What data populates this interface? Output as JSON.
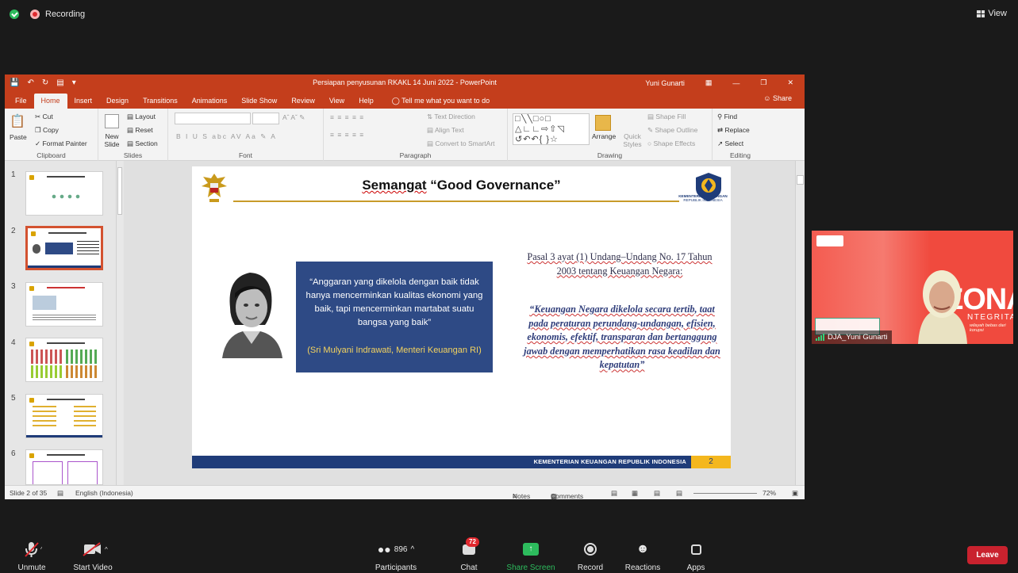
{
  "zoom": {
    "recording_label": "Recording",
    "view_label": "View",
    "toolbar": {
      "unmute": "Unmute",
      "start_video": "Start Video",
      "participants": "Participants",
      "participants_count": "896",
      "chat": "Chat",
      "chat_badge": "72",
      "share_screen": "Share Screen",
      "record": "Record",
      "reactions": "Reactions",
      "apps": "Apps",
      "leave": "Leave"
    },
    "video_tile": {
      "name": "DJA_Yuni Gunarti",
      "zona": "ZONA",
      "integritas": "NTEGRITAS",
      "tagline": "wilayah bebas dari korupsi"
    },
    "colors": {
      "record": "#e0282e",
      "share": "#2dbb5d",
      "leave": "#c9222e"
    }
  },
  "ppt": {
    "doc_title": "Persiapan penyusunan RKAKL 14 Juni 2022 - PowerPoint",
    "user": "Yuni Gunarti",
    "tabs": [
      "File",
      "Home",
      "Insert",
      "Design",
      "Transitions",
      "Animations",
      "Slide Show",
      "Review",
      "View",
      "Help"
    ],
    "active_tab": "Home",
    "tell_me": "Tell me what you want to do",
    "share": "Share",
    "ribbon": {
      "clipboard": {
        "paste": "Paste",
        "cut": "Cut",
        "copy": "Copy",
        "format_painter": "Format Painter",
        "label": "Clipboard"
      },
      "slides": {
        "new_slide": "New Slide",
        "layout": "Layout",
        "reset": "Reset",
        "section": "Section",
        "label": "Slides"
      },
      "font": {
        "label": "Font"
      },
      "paragraph": {
        "text_direction": "Text Direction",
        "align_text": "Align Text",
        "convert_smartart": "Convert to SmartArt",
        "label": "Paragraph"
      },
      "drawing": {
        "arrange": "Arrange",
        "quick_styles": "Quick Styles",
        "shape_fill": "Shape Fill",
        "shape_outline": "Shape Outline",
        "shape_effects": "Shape Effects",
        "label": "Drawing"
      },
      "editing": {
        "find": "Find",
        "replace": "Replace",
        "select": "Select",
        "label": "Editing"
      }
    },
    "thumbnails": [
      "1",
      "2",
      "3",
      "4",
      "5",
      "6"
    ],
    "selected_slide": "2",
    "slide": {
      "title_plain": "Semangat",
      "title_rest": " “Good Governance”",
      "ministry": "KEMENTERIAN KEUANGAN",
      "ministry_sub": "REPUBLIK INDONESIA",
      "quote": "“Anggaran yang dikelola dengan baik tidak hanya mencerminkan kualitas ekonomi yang baik, tapi mencerminkan martabat suatu bangsa yang baik”",
      "quote_author": "(Sri Mulyani Indrawati, Menteri Keuangan RI)",
      "pasal": "Pasal 3 ayat (1) Undang–Undang No. 17 Tahun 2003 tentang Keuangan Negara:",
      "uu_text": "“Keuangan Negara dikelola secara tertib, taat pada peraturan perundang-undangan, efisien, ekonomis, efektif, transparan dan bertanggung jawab dengan memperhatikan rasa keadilan dan kepatutan”",
      "footer": "KEMENTERIAN KEUANGAN REPUBLIK INDONESIA",
      "page_number": "2"
    },
    "status": {
      "slide_of": "Slide 2 of 35",
      "language": "English (Indonesia)",
      "notes": "Notes",
      "comments": "Comments",
      "zoom": "72%"
    }
  }
}
